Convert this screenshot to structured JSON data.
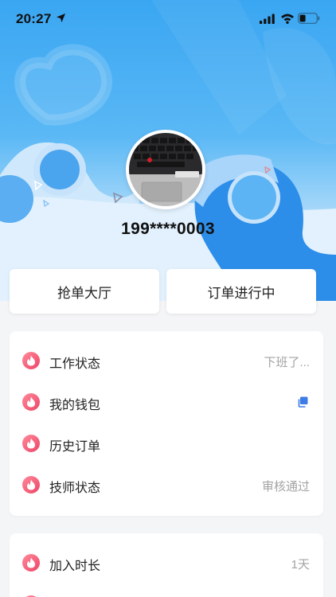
{
  "status_bar": {
    "time": "20:27"
  },
  "profile": {
    "phone": "199****0003"
  },
  "quick_actions": [
    {
      "label": "抢单大厅"
    },
    {
      "label": "订单进行中"
    }
  ],
  "menu_group_1": [
    {
      "label": "工作状态",
      "value": "下班了..."
    },
    {
      "label": "我的钱包",
      "value": ""
    },
    {
      "label": "历史订单",
      "value": ""
    },
    {
      "label": "技师状态",
      "value": "审核通过"
    }
  ],
  "menu_group_2": [
    {
      "label": "加入时长",
      "value": "1天"
    }
  ],
  "colors": {
    "header_blue": "#3aa6f2",
    "icon_pink": "#ee4466",
    "wallet_blue": "#3d7be6",
    "value_gray": "#a3a3a3"
  },
  "icons": {
    "location": "location-arrow-icon",
    "signal": "cellular-signal-icon",
    "wifi": "wifi-icon",
    "battery": "battery-icon",
    "menu": "flame-icon",
    "wallet": "copy-icon"
  }
}
